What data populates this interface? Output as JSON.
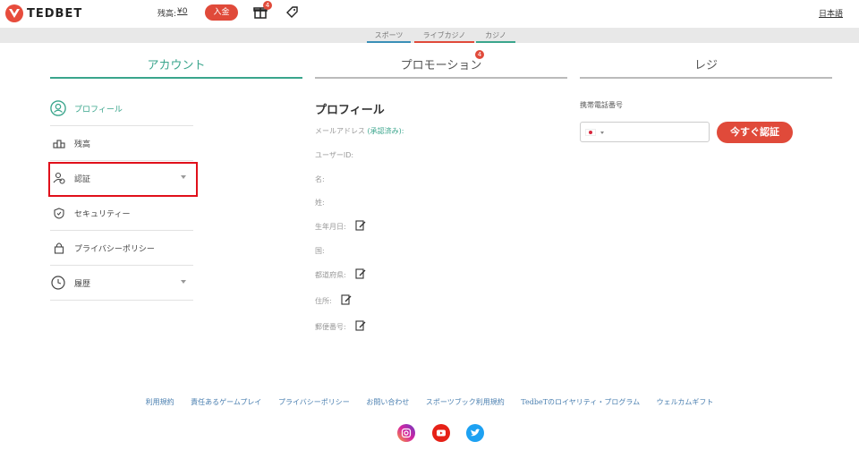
{
  "header": {
    "logo_text": "TEDBET",
    "balance_label": "残高:",
    "balance_value": "¥0",
    "deposit_label": "入金",
    "gift_badge": "4",
    "language": "日本語"
  },
  "subnav": {
    "items": [
      {
        "label": "スポーツ",
        "color": "#3a8fb7"
      },
      {
        "label": "ライブカジノ",
        "color": "#e04a3a"
      },
      {
        "label": "カジノ",
        "color": "#3aa58c"
      }
    ]
  },
  "tabs": [
    {
      "label": "アカウント",
      "active": true
    },
    {
      "label": "プロモーション",
      "badge": "4"
    },
    {
      "label": "レジ"
    }
  ],
  "sidebar": {
    "items": [
      {
        "label": "プロフィール",
        "icon": "user-circle-icon",
        "active": true
      },
      {
        "label": "残高",
        "icon": "coins-icon"
      },
      {
        "label": "認証",
        "icon": "user-check-icon",
        "expandable": true
      },
      {
        "label": "セキュリティー",
        "icon": "shield-icon"
      },
      {
        "label": "プライバシーポリシー",
        "icon": "lock-icon"
      },
      {
        "label": "履歴",
        "icon": "clock-history-icon",
        "expandable": true
      }
    ]
  },
  "profile": {
    "title": "プロフィール",
    "email_label": "メールアドレス",
    "email_status": "(承認済み):",
    "fields": [
      "ユーザーID:",
      "名:",
      "姓:",
      "生年月日:",
      "国:",
      "都道府県:",
      "住所:",
      "郵便番号:"
    ]
  },
  "register": {
    "phone_label": "携帯電話番号",
    "verify_button": "今すぐ認証"
  },
  "footer": {
    "links": [
      "利用規約",
      "責任あるゲームプレイ",
      "プライバシーポリシー",
      "お問い合わせ",
      "スポーツブック利用規約",
      "TedbeTのロイヤリティ・プログラム",
      "ウェルカムギフト"
    ]
  },
  "colors": {
    "accent": "#3aa58c",
    "brand_red": "#e04a3a",
    "link": "#4a7fb0"
  }
}
